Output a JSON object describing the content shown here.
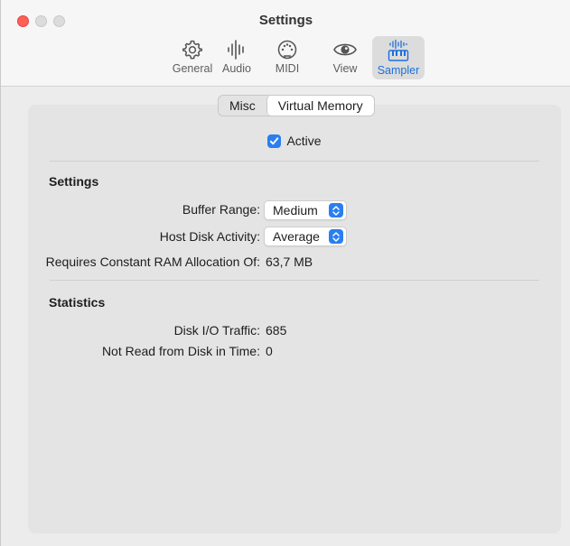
{
  "window": {
    "title": "Settings"
  },
  "toolbar": {
    "items": [
      {
        "label": "General",
        "icon": "gear-icon"
      },
      {
        "label": "Audio",
        "icon": "waveform-icon"
      },
      {
        "label": "MIDI",
        "icon": "midi-port-icon"
      },
      {
        "label": "View",
        "icon": "eye-icon"
      },
      {
        "label": "Sampler",
        "icon": "sampler-keyboard-icon",
        "selected": true
      }
    ]
  },
  "tabs": [
    {
      "label": "Misc",
      "active": false
    },
    {
      "label": "Virtual Memory",
      "active": true
    }
  ],
  "active": {
    "label": "Active",
    "checked": true
  },
  "settings": {
    "title": "Settings",
    "buffer_range": {
      "label": "Buffer Range:",
      "value": "Medium"
    },
    "host_disk_activity": {
      "label": "Host Disk Activity:",
      "value": "Average"
    },
    "ram_allocation": {
      "label": "Requires Constant RAM Allocation Of:",
      "value": "63,7 MB"
    }
  },
  "statistics": {
    "title": "Statistics",
    "disk_io": {
      "label": "Disk I/O Traffic:",
      "value": "685"
    },
    "not_read": {
      "label": "Not Read from Disk in Time:",
      "value": "0"
    }
  },
  "colors": {
    "accent": "#2a7ef0",
    "close": "#fe5f57"
  }
}
